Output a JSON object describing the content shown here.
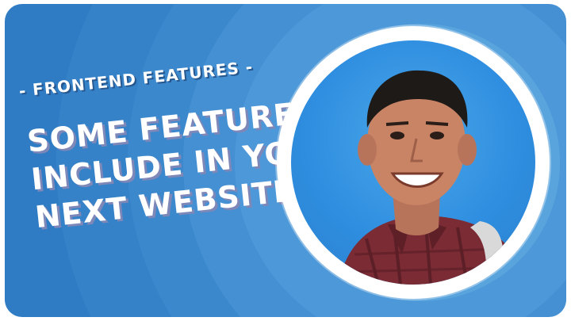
{
  "kicker": "- FRONTEND FEATURES -",
  "headline": {
    "line1": "SOME FEATURES TO",
    "line2": "INCLUDE IN YOUR",
    "line3": "NEXT WEBSITE"
  },
  "colors": {
    "background": "#3582c9",
    "ring": "#ffffff",
    "text": "#ffffff"
  }
}
